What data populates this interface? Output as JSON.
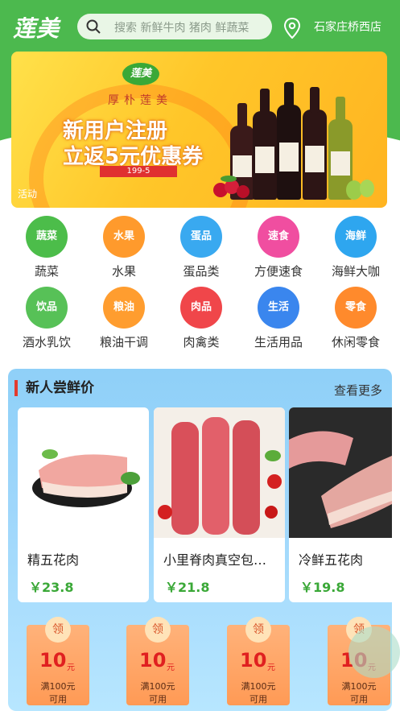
{
  "header": {
    "logo_text": "莲美",
    "search_placeholder": "搜索 新鲜牛肉 猪肉 鲜蔬菜",
    "location": "石家庄桥西店"
  },
  "banner": {
    "badge": "莲美",
    "slogan": "厚朴莲美",
    "title_line1": "新用户注册",
    "title_line2": "立返5元优惠券",
    "code": "199-5",
    "tag": "活动"
  },
  "categories": [
    {
      "icon_label": "蔬菜",
      "name": "蔬菜",
      "color": "#4cbd4a"
    },
    {
      "icon_label": "水果",
      "name": "水果",
      "color": "#ff9a2c"
    },
    {
      "icon_label": "蛋品",
      "name": "蛋品类",
      "color": "#39a9f0"
    },
    {
      "icon_label": "速食",
      "name": "方便速食",
      "color": "#f04ea0"
    },
    {
      "icon_label": "海鲜",
      "name": "海鲜大咖",
      "color": "#2ea6ef"
    },
    {
      "icon_label": "饮品",
      "name": "酒水乳饮",
      "color": "#57c157"
    },
    {
      "icon_label": "粮油",
      "name": "粮油干调",
      "color": "#ff9d2f"
    },
    {
      "icon_label": "肉品",
      "name": "肉禽类",
      "color": "#f0464a"
    },
    {
      "icon_label": "生活",
      "name": "生活用品",
      "color": "#3a86ee"
    },
    {
      "icon_label": "零食",
      "name": "休闲零食",
      "color": "#ff8a2c"
    }
  ],
  "section": {
    "title": "新人尝鲜价",
    "more": "查看更多"
  },
  "products": [
    {
      "name": "精五花肉",
      "price": "￥23.8"
    },
    {
      "name": "小里脊肉真空包…",
      "price": "￥21.8"
    },
    {
      "name": "冷鲜五花肉",
      "price": "￥19.8"
    }
  ],
  "coupons": [
    {
      "ling": "领",
      "amount": "10",
      "unit": "元",
      "condition": "满100元",
      "use": "可用"
    },
    {
      "ling": "领",
      "amount": "10",
      "unit": "元",
      "condition": "满100元",
      "use": "可用"
    },
    {
      "ling": "领",
      "amount": "10",
      "unit": "元",
      "condition": "满100元",
      "use": "可用"
    },
    {
      "ling": "领",
      "amount": "10",
      "unit": "元",
      "condition": "满100元",
      "use": "可用"
    }
  ]
}
